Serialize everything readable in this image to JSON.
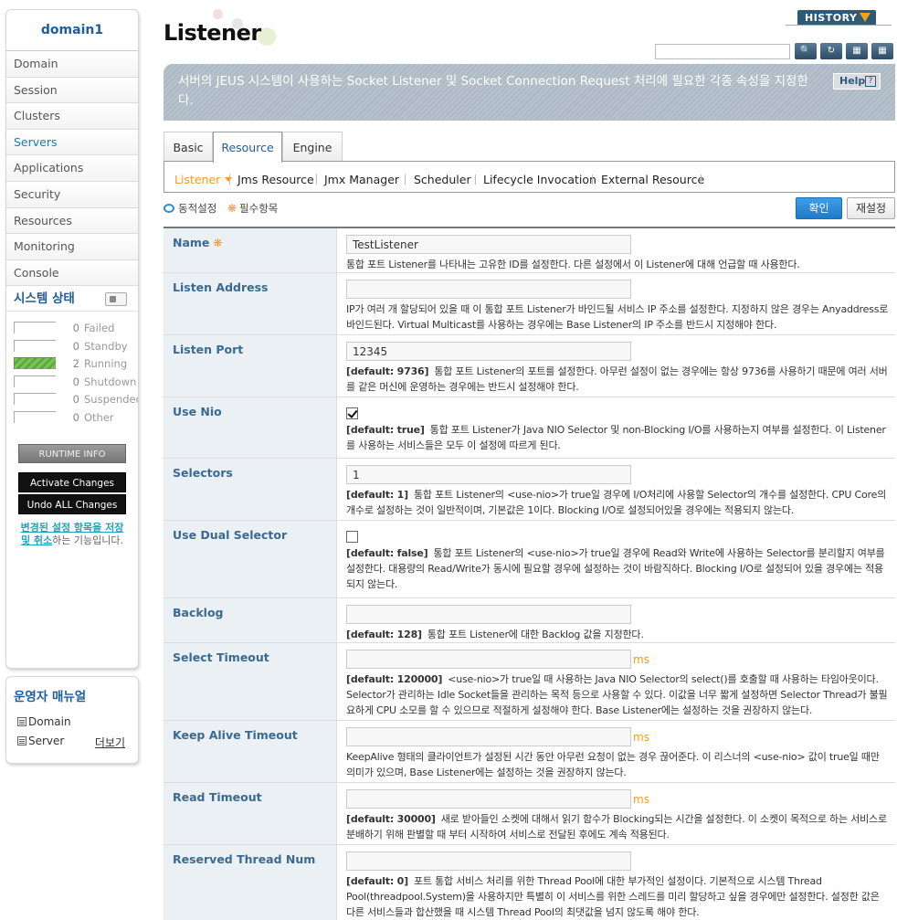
{
  "sidebar": {
    "domain": "domain1",
    "nav": [
      "Domain",
      "Session",
      "Clusters",
      "Servers",
      "Applications",
      "Security",
      "Resources",
      "Monitoring",
      "Console"
    ],
    "active_nav": "Servers",
    "status_title": "시스템 상태",
    "status": [
      {
        "count": "0",
        "label": "Failed",
        "filled": 0
      },
      {
        "count": "0",
        "label": "Standby",
        "filled": 0
      },
      {
        "count": "2",
        "label": "Running",
        "filled": 1
      },
      {
        "count": "0",
        "label": "Shutdown",
        "filled": 0
      },
      {
        "count": "0",
        "label": "Suspended",
        "filled": 0
      },
      {
        "count": "0",
        "label": "Other",
        "filled": 0
      }
    ],
    "runtime_info": "RUNTIME INFO",
    "activate": "Activate Changes",
    "undo": "Undo ALL Changes",
    "note_em": "변경된 설정 항목을 저장 및 취소",
    "note_rest": "하는 기능입니다.",
    "manual_title": "운영자 매뉴얼",
    "manual_items": [
      "Domain",
      "Server"
    ],
    "more": "더보기"
  },
  "header": {
    "title": "Listener",
    "history": "HISTORY",
    "search_value": "",
    "description": "서버의 JEUS 시스템이 사용하는 Socket Listener 및 Socket Connection Request 처리에 필요한 각종 속성을 지정한다.",
    "help": "Help",
    "help_mark": "?"
  },
  "tabs": [
    "Basic",
    "Resource",
    "Engine"
  ],
  "active_tab": "Resource",
  "subtabs": [
    "Listener",
    "Jms Resource",
    "Jmx Manager",
    "Scheduler",
    "Lifecycle Invocation",
    "External Resource"
  ],
  "active_subtab": "Listener",
  "legend": {
    "dynamic": "동적설정",
    "required": "필수항목"
  },
  "actions": {
    "confirm": "확인",
    "reset": "재설정"
  },
  "colors": {
    "accent": "#1e5d9c",
    "required": "#f39a1e",
    "running": "#6bb84a"
  },
  "rows": [
    {
      "label": "Name",
      "required": true,
      "type": "text",
      "value": "TestListener",
      "default": "",
      "desc": "통합 포트 Listener를 나타내는 고유한 ID를 설정한다. 다른 설정에서 이 Listener에 대해 언급할 때 사용한다."
    },
    {
      "label": "Listen Address",
      "type": "text",
      "value": "",
      "default": "",
      "desc": "IP가 여러 개 할당되어 있을 때 이 통합 포트 Listener가 바인드될 서비스 IP 주소를 설정한다. 지정하지 않은 경우는 Anyaddress로 바인드된다. Virtual Multicast를 사용하는 경우에는 Base Listener의 IP 주소를 반드시 지정해야 한다."
    },
    {
      "label": "Listen Port",
      "type": "text",
      "value": "12345",
      "default": "[default: 9736]",
      "desc": "통합 포트 Listener의 포트를 설정한다. 아무런 설정이 없는 경우에는 항상 9736를 사용하기 때문에 여러 서버를 같은 머신에 운영하는 경우에는 반드시 설정해야 한다."
    },
    {
      "label": "Use Nio",
      "type": "check",
      "checked": true,
      "default": "[default: true]",
      "desc": "통합 포트 Listener가 Java NIO Selector 및 non-Blocking I/O를 사용하는지 여부를 설정한다. 이 Listener를 사용하는 서비스들은 모두 이 설정에 따르게 된다."
    },
    {
      "label": "Selectors",
      "type": "text",
      "value": "1",
      "default": "[default: 1]",
      "desc": "통합 포트 Listener의 <use-nio>가 true일 경우에 I/O처리에 사용할 Selector의 개수를 설정한다. CPU Core의 개수로 설정하는 것이 일반적이며, 기본값은 1이다. Blocking I/O로 설정되어있을 경우에는 적용되지 않는다."
    },
    {
      "label": "Use Dual Selector",
      "type": "check",
      "checked": false,
      "default": "[default: false]",
      "desc": "통합 포트 Listener의 <use-nio>가 true일 경우에 Read와 Write에 사용하는 Selector를 분리할지 여부를 설정한다. 대용량의 Read/Write가 동시에 필요할 경우에 설정하는 것이 바람직하다. Blocking I/O로 설정되어 있을 경우에는 적용되지 않는다."
    },
    {
      "label": "Backlog",
      "type": "text",
      "value": "",
      "default": "[default: 128]",
      "desc": "통합 포트 Listener에 대한 Backlog 값을 지정한다."
    },
    {
      "label": "Select Timeout",
      "type": "text",
      "value": "",
      "unit": "ms",
      "default": "[default: 120000]",
      "desc": "<use-nio>가 true일 때 사용하는 Java NIO Selector의 select()를 호출할 때 사용하는 타임아웃이다. Selector가 관리하는 Idle Socket들을 관리하는 목적 등으로 사용할 수 있다. 이값을 너무 짧게 설정하면 Selector Thread가 불필요하게 CPU 소모를 할 수 있으므로 적절하게 설정해야 한다. Base Listener에는 설정하는 것을 권장하지 않는다."
    },
    {
      "label": "Keep Alive Timeout",
      "type": "text",
      "value": "",
      "unit": "ms",
      "default": "",
      "desc": "KeepAlive 형태의 클라이언트가 설정된 시간 동안 아무런 요청이 없는 경우 끊어준다. 이 리스너의 <use-nio> 값이 true일 때만 의미가 있으며, Base Listener에는 설정하는 것을 권장하지 않는다."
    },
    {
      "label": "Read Timeout",
      "type": "text",
      "value": "",
      "unit": "ms",
      "default": "[default: 30000]",
      "desc": "새로 받아들인 소켓에 대해서 읽기 함수가 Blocking되는 시간을 설정한다. 이 소켓이 목적으로 하는 서비스로 분배하기 위해 판별할 때 부터 시작하여 서비스로 전달된 후에도 계속 적용된다."
    },
    {
      "label": "Reserved Thread Num",
      "type": "text",
      "value": "",
      "default": "[default: 0]",
      "desc": "포트 통합 서비스 처리를 위한 Thread Pool에 대한 부가적인 설정이다. 기본적으로 시스템 Thread Pool(threadpool.System)을 사용하지만 특별히 이 서비스를 위한 스레드를 미리 할당하고 싶을 경우에만 설정한다. 설정한 값은 다른 서비스들과 합산했을 때 시스템 Thread Pool의 최댓값을 넘지 않도록 해야 한다."
    }
  ]
}
